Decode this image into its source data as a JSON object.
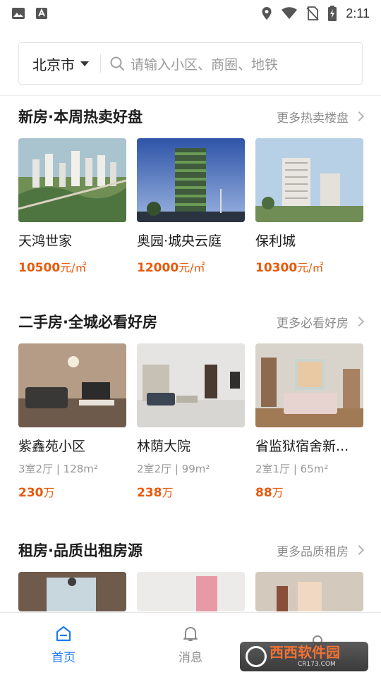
{
  "status_bar": {
    "time": "2:11"
  },
  "search": {
    "city": "北京市",
    "placeholder": "请输入小区、商圈、地铁"
  },
  "sections": [
    {
      "title": "新房·本周热卖好盘",
      "more": "更多热卖楼盘",
      "items": [
        {
          "name": "天鸿世家",
          "price": "10500",
          "unit": "元/㎡"
        },
        {
          "name": "奥园·城央云庭",
          "price": "12000",
          "unit": "元/㎡"
        },
        {
          "name": "保利城",
          "price": "10300",
          "unit": "元/㎡"
        }
      ]
    },
    {
      "title": "二手房·全城必看好房",
      "more": "更多必看好房",
      "items": [
        {
          "name": "紫鑫苑小区",
          "meta": "3室2厅 | 128m²",
          "price": "230",
          "unit": "万"
        },
        {
          "name": "林荫大院",
          "meta": "2室2厅 | 99m²",
          "price": "238",
          "unit": "万"
        },
        {
          "name": "省监狱宿舍新...",
          "meta": "2室1厅 | 65m²",
          "price": "88",
          "unit": "万"
        }
      ]
    },
    {
      "title": "租房·品质出租房源",
      "more": "更多品质租房"
    }
  ],
  "bottom_nav": [
    {
      "label": "首页",
      "icon": "home-icon",
      "active": true
    },
    {
      "label": "消息",
      "icon": "bell-icon",
      "active": false
    },
    {
      "label": "",
      "icon": "user-icon",
      "active": false
    }
  ],
  "colors": {
    "accent": "#1e7bf0",
    "price": "#e8590c"
  },
  "watermark": {
    "text": "西西软件园",
    "sub": "CR173.COM"
  }
}
